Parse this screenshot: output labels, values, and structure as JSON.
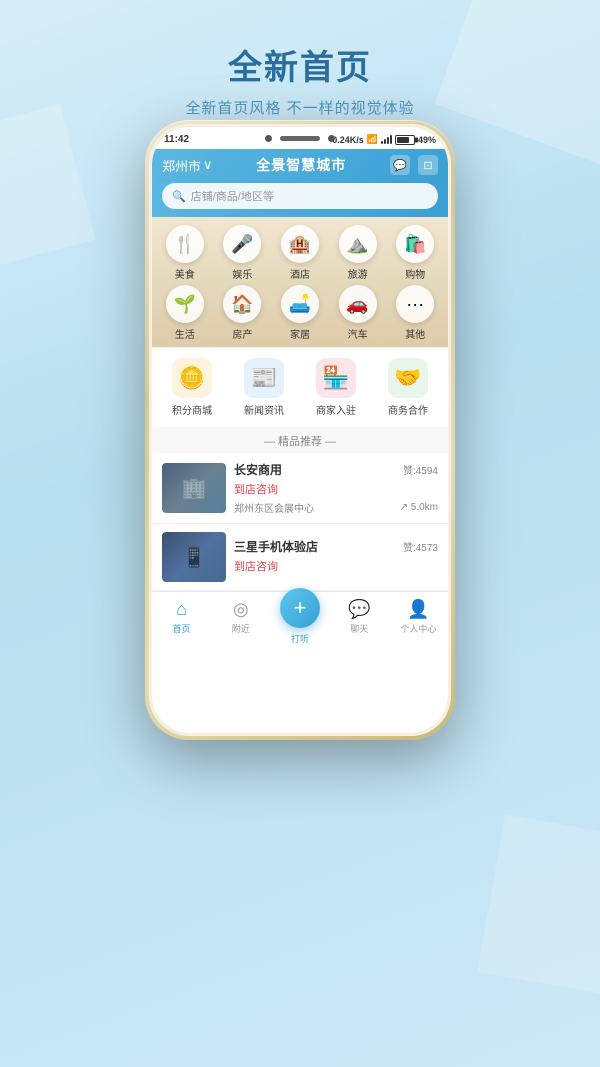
{
  "page": {
    "background_color": "#b8ddf0",
    "header": {
      "title": "全新首页",
      "subtitle": "全新首页风格 不一样的视觉体验"
    }
  },
  "phone": {
    "status_bar": {
      "time": "11:42",
      "signal": "0.24K/s",
      "battery": "49%"
    },
    "app_header": {
      "city": "郑州市",
      "title": "全景智慧城市",
      "dropdown_arrow": "∨"
    },
    "search": {
      "placeholder": "店铺/商品/地区等",
      "icon": "🔍"
    },
    "categories": [
      {
        "label": "美食",
        "icon": "🍴",
        "color": "#ff9966"
      },
      {
        "label": "娱乐",
        "icon": "🎤",
        "color": "#cc88ff"
      },
      {
        "label": "酒店",
        "icon": "🏨",
        "color": "#8866ff"
      },
      {
        "label": "旅游",
        "icon": "⛰️",
        "color": "#44bb66"
      },
      {
        "label": "购物",
        "icon": "🛍️",
        "color": "#ff6699"
      },
      {
        "label": "生活",
        "icon": "🌱",
        "color": "#44cc44"
      },
      {
        "label": "房产",
        "icon": "🏠",
        "color": "#44aaff"
      },
      {
        "label": "家居",
        "icon": "🛋️",
        "color": "#ffaa44"
      },
      {
        "label": "汽车",
        "icon": "🚗",
        "color": "#ff6666"
      },
      {
        "label": "其他",
        "icon": "···",
        "color": "#99aabb"
      }
    ],
    "quick_access": [
      {
        "label": "积分商城",
        "icon": "🪙",
        "bg": "#fff3e0"
      },
      {
        "label": "新闻资讯",
        "icon": "📰",
        "bg": "#e3f2fd"
      },
      {
        "label": "商家入驻",
        "icon": "🏪",
        "bg": "#fce4ec"
      },
      {
        "label": "商务合作",
        "icon": "🤝",
        "bg": "#e8f5e9"
      }
    ],
    "section_title": "— 精品推荐 —",
    "recommendations": [
      {
        "name": "长安商用",
        "likes": "赞:4594",
        "action": "到店咨询",
        "address": "郑州东区会展中心",
        "distance": "5.0km",
        "thumb_class": "thumb-1"
      },
      {
        "name": "三星手机体验店",
        "likes": "赞:4573",
        "action": "到店咨询",
        "address": "",
        "distance": "",
        "thumb_class": "thumb-2"
      }
    ],
    "bottom_nav": [
      {
        "label": "首页",
        "icon": "⌂",
        "active": true
      },
      {
        "label": "附近",
        "icon": "◎",
        "active": false
      },
      {
        "label": "打听",
        "icon": "+",
        "active": false,
        "is_plus": true
      },
      {
        "label": "聊天",
        "icon": "💬",
        "active": false
      },
      {
        "label": "个人中心",
        "icon": "👤",
        "active": false
      }
    ]
  }
}
